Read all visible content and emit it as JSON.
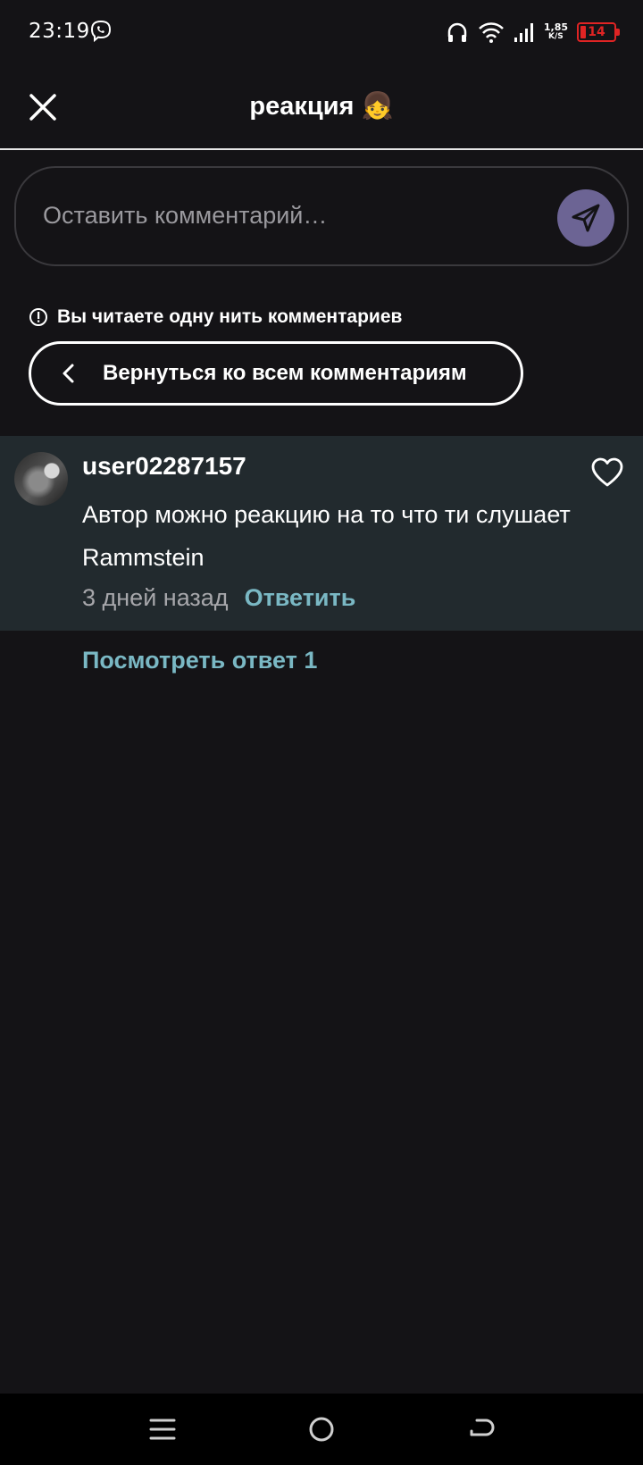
{
  "status": {
    "time": "23:19",
    "speed_value": "1,85",
    "speed_unit": "K/S",
    "battery": "14",
    "battery_level": 0.14
  },
  "header": {
    "title": "реакция 👧"
  },
  "composer": {
    "placeholder": "Оставить комментарий…"
  },
  "thread": {
    "notice": "Вы читаете одну нить комментариев",
    "back_label": "Вернуться ко всем комментариям"
  },
  "comment": {
    "username": "user02287157",
    "text": "Автор можно реакцию на то что ти слушает Rammstein",
    "time": "3 дней назад",
    "reply_label": "Ответить"
  },
  "view_replies_label": "Посмотреть ответ 1",
  "colors": {
    "background": "#141316",
    "accent": "#7ab8c4",
    "send_button": "#6c6494",
    "comment_bg": "#222a2e"
  }
}
